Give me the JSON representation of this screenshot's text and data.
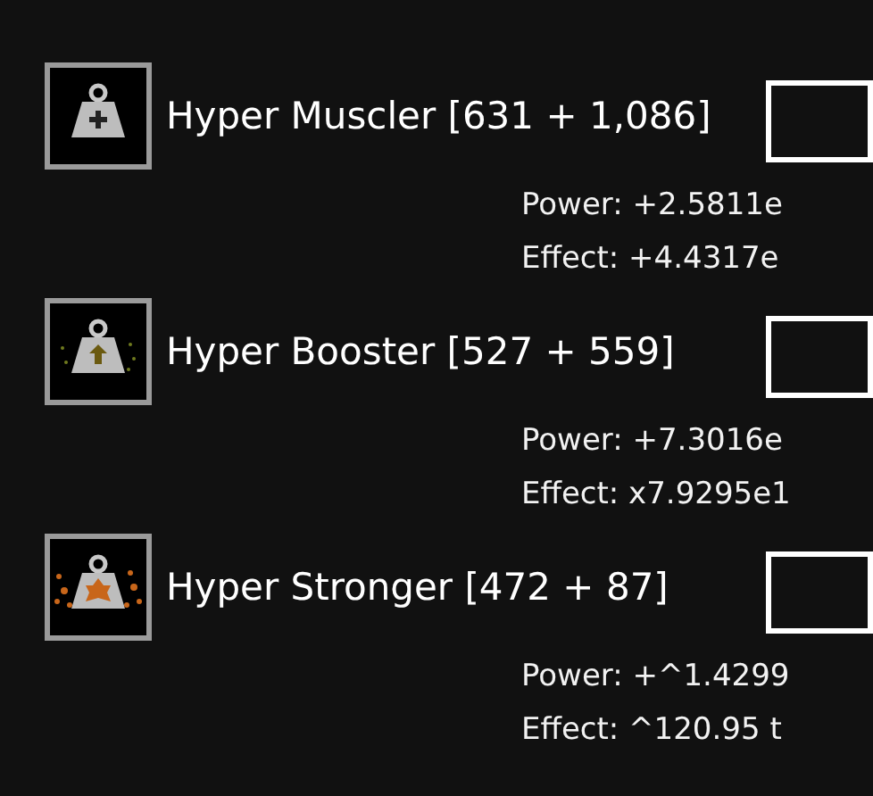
{
  "upgrades": [
    {
      "kind": "plus",
      "title": "Hyper Muscler [631 + 1,086]",
      "power": "Power: +2.5811e",
      "effect": "Effect: +4.4317e"
    },
    {
      "kind": "arrow",
      "title": "Hyper Booster [527 + 559]",
      "power": "Power: +7.3016e",
      "effect": "Effect: x7.9295e1"
    },
    {
      "kind": "burst",
      "title": "Hyper Stronger [472 + 87]",
      "power": "Power: +^1.4299",
      "effect": "Effect: ^120.95 t"
    }
  ]
}
